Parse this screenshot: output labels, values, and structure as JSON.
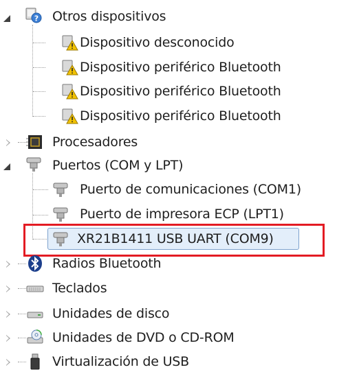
{
  "tree": {
    "otros": {
      "label": "Otros dispositivos",
      "icon": "unknown-device-icon",
      "expanded": true,
      "children": [
        {
          "label": "Dispositivo desconocido",
          "icon": "warning-device-icon"
        },
        {
          "label": "Dispositivo periférico Bluetooth",
          "icon": "warning-device-icon"
        },
        {
          "label": "Dispositivo periférico Bluetooth",
          "icon": "warning-device-icon"
        },
        {
          "label": "Dispositivo periférico Bluetooth",
          "icon": "warning-device-icon"
        }
      ]
    },
    "procesadores": {
      "label": "Procesadores",
      "icon": "processor-icon",
      "expanded": false
    },
    "puertos": {
      "label": "Puertos (COM y LPT)",
      "icon": "port-icon",
      "expanded": true,
      "children": [
        {
          "label": "Puerto de comunicaciones (COM1)",
          "icon": "port-icon"
        },
        {
          "label": "Puerto de impresora ECP (LPT1)",
          "icon": "port-icon"
        },
        {
          "label": "XR21B1411 USB UART (COM9)",
          "icon": "port-icon",
          "selected": true
        }
      ]
    },
    "radios": {
      "label": "Radios Bluetooth",
      "icon": "bluetooth-icon",
      "expanded": false
    },
    "teclados": {
      "label": "Teclados",
      "icon": "keyboard-icon",
      "expanded": false
    },
    "discos": {
      "label": "Unidades de disco",
      "icon": "disk-drive-icon",
      "expanded": false
    },
    "dvd": {
      "label": "Unidades de DVD o CD-ROM",
      "icon": "dvd-drive-icon",
      "expanded": false
    },
    "usb": {
      "label": "Virtualización de USB",
      "icon": "usb-icon",
      "expanded": false
    }
  },
  "colors": {
    "highlight_frame": "#e31b23",
    "selection_fill": "#e3eefa",
    "selection_border": "#7da2ce",
    "warning": "#f2c200"
  }
}
